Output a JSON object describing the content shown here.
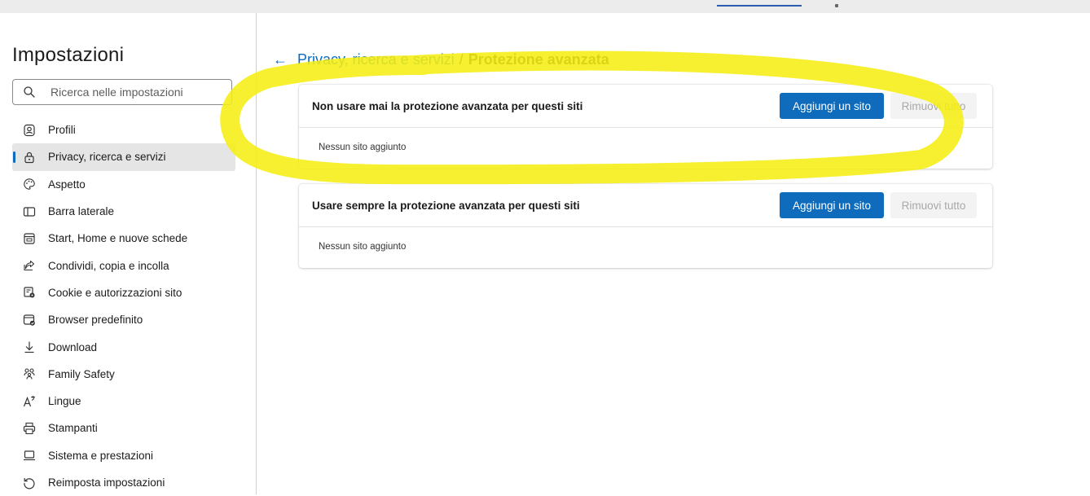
{
  "sidebar": {
    "title": "Impostazioni",
    "search_placeholder": "Ricerca nelle impostazioni",
    "items": [
      {
        "label": "Profili",
        "icon": "profile-icon"
      },
      {
        "label": "Privacy, ricerca e servizi",
        "icon": "lock-icon",
        "active": true
      },
      {
        "label": "Aspetto",
        "icon": "palette-icon"
      },
      {
        "label": "Barra laterale",
        "icon": "sidebar-icon"
      },
      {
        "label": "Start, Home e nuove schede",
        "icon": "home-tab-icon"
      },
      {
        "label": "Condividi, copia e incolla",
        "icon": "share-icon"
      },
      {
        "label": "Cookie e autorizzazioni sito",
        "icon": "cookie-permissions-icon"
      },
      {
        "label": "Browser predefinito",
        "icon": "default-browser-icon"
      },
      {
        "label": "Download",
        "icon": "download-icon"
      },
      {
        "label": "Family Safety",
        "icon": "family-icon"
      },
      {
        "label": "Lingue",
        "icon": "language-icon"
      },
      {
        "label": "Stampanti",
        "icon": "printer-icon"
      },
      {
        "label": "Sistema e prestazioni",
        "icon": "laptop-icon"
      },
      {
        "label": "Reimposta impostazioni",
        "icon": "reset-icon"
      }
    ]
  },
  "breadcrumb": {
    "back_glyph": "←",
    "parent": "Privacy, ricerca e servizi",
    "separator": "/",
    "current": "Protezione avanzata"
  },
  "cards": [
    {
      "title": "Non usare mai la protezione avanzata per questi siti",
      "add_label": "Aggiungi un sito",
      "remove_label": "Rimuovi tutto",
      "empty_text": "Nessun sito aggiunto"
    },
    {
      "title": "Usare sempre la protezione avanzata per questi siti",
      "add_label": "Aggiungi un sito",
      "remove_label": "Rimuovi tutto",
      "empty_text": "Nessun sito aggiunto"
    }
  ],
  "colors": {
    "accent": "#0f6cbd",
    "highlight_annotation": "#f7f018"
  }
}
